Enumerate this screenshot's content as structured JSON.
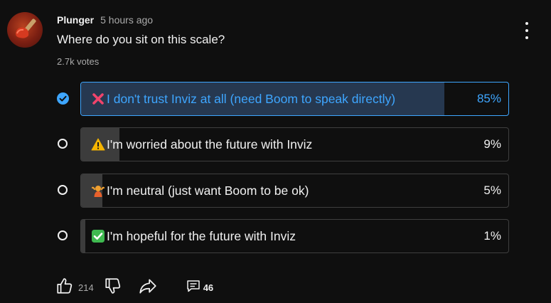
{
  "post": {
    "author": "Plunger",
    "timestamp": "5 hours ago",
    "question": "Where do you sit on this scale?",
    "votes": "2.7k votes",
    "avatar_icon": "plunger-icon"
  },
  "poll": {
    "options": [
      {
        "emoji": "cross-mark-icon",
        "label": "I don't trust Inviz at all (need Boom to speak directly)",
        "percent_label": "85%",
        "percent": 85,
        "selected": true
      },
      {
        "emoji": "warning-icon",
        "label": "I'm worried about the future with Inviz",
        "percent_label": "9%",
        "percent": 9,
        "selected": false
      },
      {
        "emoji": "shrug-icon",
        "label": "I'm neutral (just want Boom to be ok)",
        "percent_label": "5%",
        "percent": 5,
        "selected": false
      },
      {
        "emoji": "check-mark-button-icon",
        "label": "I'm hopeful for the future with Inviz",
        "percent_label": "1%",
        "percent": 1,
        "selected": false
      }
    ]
  },
  "actions": {
    "like_icon": "thumbs-up-icon",
    "like_count": "214",
    "dislike_icon": "thumbs-down-icon",
    "share_icon": "share-icon",
    "comment_icon": "comment-icon",
    "comment_count": "46"
  },
  "colors": {
    "background": "#0f0f0f",
    "accent": "#3ea6ff",
    "selected_fill": "#263850",
    "bar_fill": "#3c3c3c",
    "muted_text": "#aaaaaa"
  }
}
